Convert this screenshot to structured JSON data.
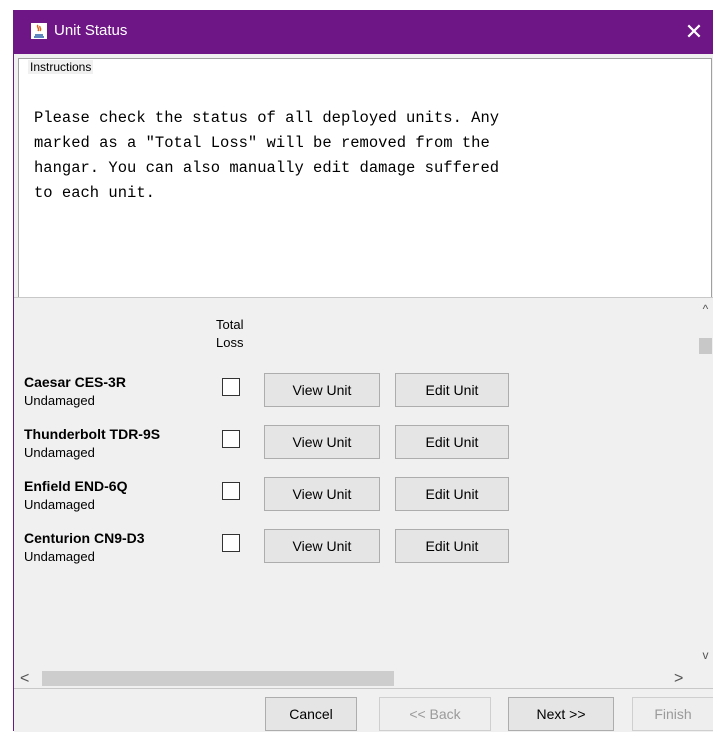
{
  "window": {
    "title": "Unit Status",
    "close_glyph": "✕",
    "title_bar_color": "#6f1686"
  },
  "instructions": {
    "legend": "Instructions",
    "text": "Please check the status of all deployed units. Any\nmarked as a \"Total Loss\" will be removed from the\nhangar. You can also manually edit damage suffered\nto each unit."
  },
  "table": {
    "total_loss_header": "Total\nLoss",
    "view_label": "View Unit",
    "edit_label": "Edit Unit",
    "units": [
      {
        "name": "Caesar CES-3R",
        "status": "Undamaged",
        "total_loss": false
      },
      {
        "name": "Thunderbolt TDR-9S",
        "status": "Undamaged",
        "total_loss": false
      },
      {
        "name": "Enfield END-6Q",
        "status": "Undamaged",
        "total_loss": false
      },
      {
        "name": "Centurion CN9-D3",
        "status": "Undamaged",
        "total_loss": false
      }
    ]
  },
  "scrollbars": {
    "up_icon": "^",
    "down_icon": "v",
    "left_icon": "<",
    "right_icon": ">"
  },
  "footer": {
    "cancel": "Cancel",
    "back": "<< Back",
    "next": "Next >>",
    "finish": "Finish"
  }
}
